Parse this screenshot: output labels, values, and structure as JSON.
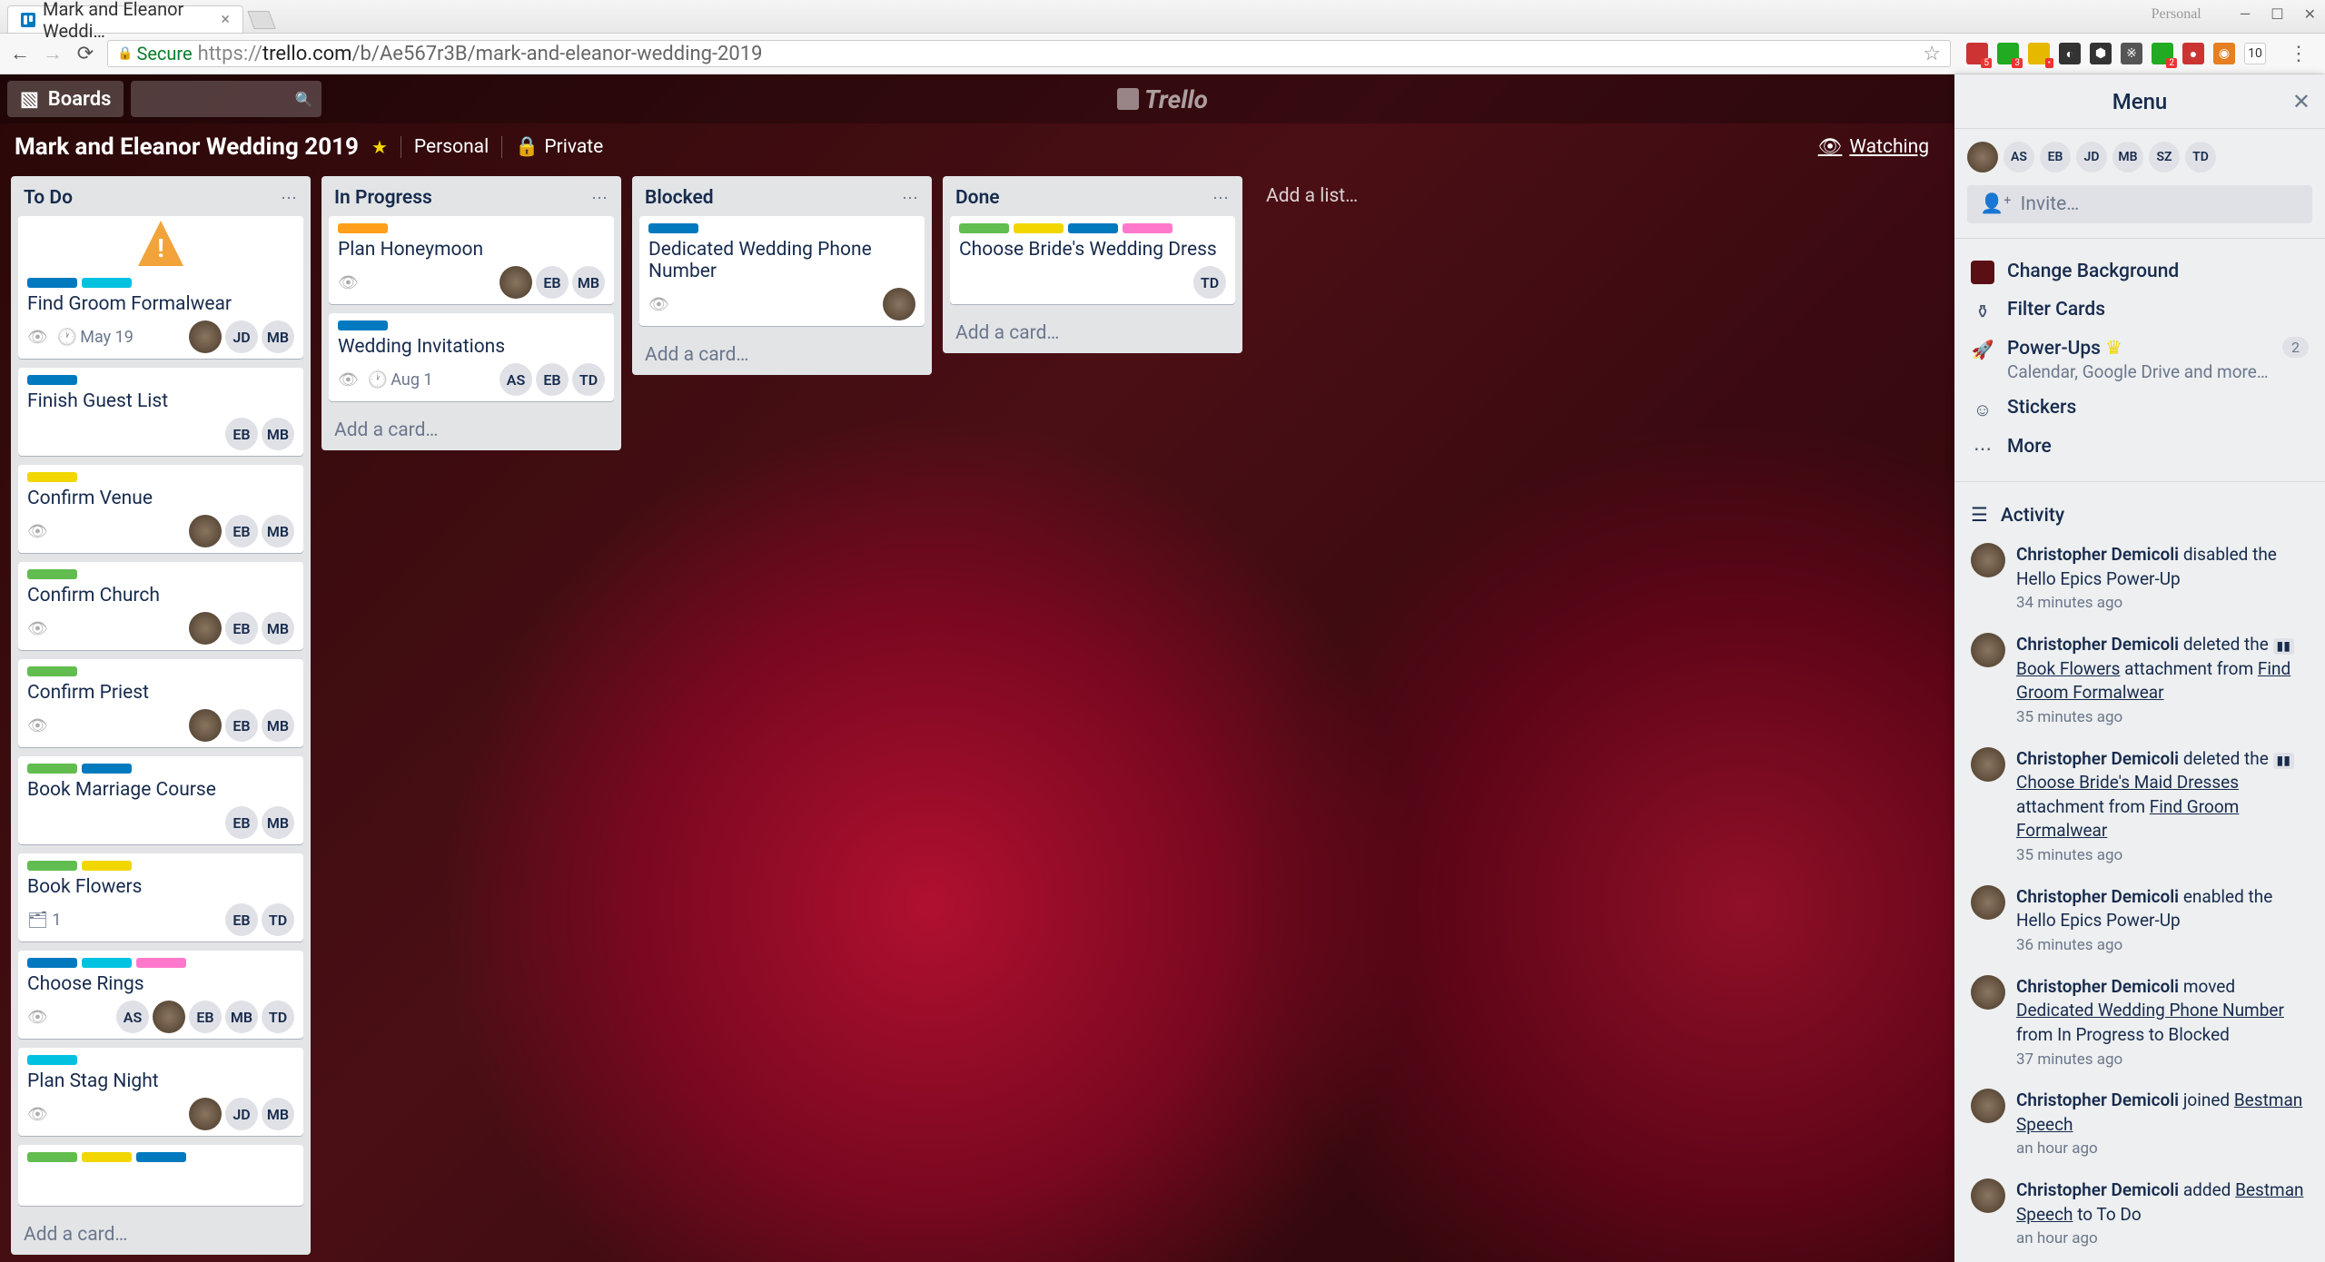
{
  "browser": {
    "tab_title": "Mark and Eleanor Weddi…",
    "url_secure": "Secure",
    "url_display_prefix": "https://",
    "url_host": "trello.com",
    "url_path": "/b/Ae567r3B/mark-and-eleanor-wedding-2019",
    "window_label": "Personal",
    "ext_badge_count": "10"
  },
  "app": {
    "boards_label": "Boards",
    "logo": "Trello"
  },
  "board": {
    "title": "Mark and Eleanor Wedding 2019",
    "team": "Personal",
    "privacy": "Private",
    "watching": "Watching",
    "add_list": "Add a list…"
  },
  "add_card_label": "Add a card…",
  "lists": [
    {
      "name": "To Do",
      "cards": [
        {
          "title": "Find Groom Formalwear",
          "labels": [
            "blue",
            "sky"
          ],
          "has_cover": true,
          "watch": true,
          "due": "May 19",
          "members": [
            "img",
            "JD",
            "MB"
          ]
        },
        {
          "title": "Finish Guest List",
          "labels": [
            "blue"
          ],
          "members": [
            "EB",
            "MB"
          ]
        },
        {
          "title": "Confirm Venue",
          "labels": [
            "yellow"
          ],
          "watch": true,
          "members": [
            "img",
            "EB",
            "MB"
          ]
        },
        {
          "title": "Confirm Church",
          "labels": [
            "green"
          ],
          "watch": true,
          "members": [
            "img",
            "EB",
            "MB"
          ]
        },
        {
          "title": "Confirm Priest",
          "labels": [
            "green"
          ],
          "watch": true,
          "members": [
            "img",
            "EB",
            "MB"
          ]
        },
        {
          "title": "Book Marriage Course",
          "labels": [
            "green",
            "blue"
          ],
          "members": [
            "EB",
            "MB"
          ]
        },
        {
          "title": "Book Flowers",
          "labels": [
            "green",
            "yellow"
          ],
          "attach": "1",
          "members": [
            "EB",
            "TD"
          ]
        },
        {
          "title": "Choose Rings",
          "labels": [
            "blue",
            "sky",
            "pink"
          ],
          "watch": true,
          "members": [
            "AS",
            "img",
            "EB",
            "MB",
            "TD"
          ]
        },
        {
          "title": "Plan Stag Night",
          "labels": [
            "sky"
          ],
          "watch": true,
          "members": [
            "img",
            "JD",
            "MB"
          ]
        },
        {
          "title": "",
          "labels": [
            "green",
            "yellow",
            "blue"
          ],
          "members": []
        }
      ]
    },
    {
      "name": "In Progress",
      "cards": [
        {
          "title": "Plan Honeymoon",
          "labels": [
            "orange"
          ],
          "watch": true,
          "members": [
            "img",
            "EB",
            "MB"
          ]
        },
        {
          "title": "Wedding Invitations",
          "labels": [
            "blue"
          ],
          "watch": true,
          "due": "Aug 1",
          "members": [
            "AS",
            "EB",
            "TD"
          ]
        }
      ]
    },
    {
      "name": "Blocked",
      "cards": [
        {
          "title": "Dedicated Wedding Phone Number",
          "labels": [
            "blue"
          ],
          "watch": true,
          "members": [
            "img"
          ]
        }
      ]
    },
    {
      "name": "Done",
      "cards": [
        {
          "title": "Choose Bride's Wedding Dress",
          "labels": [
            "green",
            "yellow",
            "blue",
            "pink"
          ],
          "members": [
            "TD"
          ]
        }
      ]
    }
  ],
  "menu": {
    "title": "Menu",
    "members": [
      "img",
      "AS",
      "EB",
      "JD",
      "MB",
      "SZ",
      "TD"
    ],
    "invite": "Invite…",
    "change_bg": "Change Background",
    "filter": "Filter Cards",
    "powerups": "Power-Ups",
    "powerups_sub": "Calendar, Google Drive and more…",
    "powerups_count": "2",
    "stickers": "Stickers",
    "more": "More",
    "activity_label": "Activity",
    "activity": [
      {
        "user": "Christopher Demicoli",
        "action": " disabled the Hello Epics Power-Up",
        "time": "34 minutes ago"
      },
      {
        "user": "Christopher Demicoli",
        "action": " deleted the ",
        "card": "Book Flowers",
        "suffix": " attachment from ",
        "link": "Find Groom Formalwear",
        "time": "35 minutes ago"
      },
      {
        "user": "Christopher Demicoli",
        "action": " deleted the ",
        "card": "Choose Bride's Maid Dresses",
        "suffix": " attachment from ",
        "link": "Find Groom Formalwear",
        "time": "35 minutes ago"
      },
      {
        "user": "Christopher Demicoli",
        "action": " enabled the Hello Epics Power-Up",
        "time": "36 minutes ago"
      },
      {
        "user": "Christopher Demicoli",
        "action": " moved ",
        "link": "Dedicated Wedding Phone Number",
        "suffix": " from In Progress to Blocked",
        "time": "37 minutes ago"
      },
      {
        "user": "Christopher Demicoli",
        "action": " joined ",
        "link": "Bestman Speech",
        "time": "an hour ago"
      },
      {
        "user": "Christopher Demicoli",
        "action": " added ",
        "link": "Bestman Speech",
        "suffix": " to To Do",
        "time": "an hour ago"
      }
    ]
  }
}
